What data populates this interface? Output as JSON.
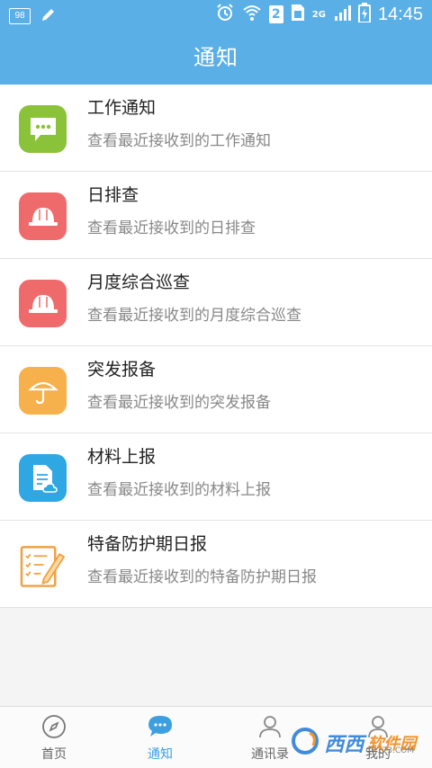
{
  "status_bar": {
    "battery_text": "98",
    "sim_number": "2",
    "network": "2G",
    "time": "14:45"
  },
  "header": {
    "title": "通知"
  },
  "notifications": [
    {
      "title": "工作通知",
      "subtitle": "查看最近接收到的工作通知",
      "icon": "message-icon",
      "color": "#8ac23a"
    },
    {
      "title": "日排查",
      "subtitle": "查看最近接收到的日排查",
      "icon": "helmet-icon",
      "color": "#ef6b6b"
    },
    {
      "title": "月度综合巡查",
      "subtitle": "查看最近接收到的月度综合巡查",
      "icon": "helmet-icon",
      "color": "#ef6b6b"
    },
    {
      "title": "突发报备",
      "subtitle": "查看最近接收到的突发报备",
      "icon": "umbrella-icon",
      "color": "#f6b14c"
    },
    {
      "title": "材料上报",
      "subtitle": "查看最近接收到的材料上报",
      "icon": "document-cloud-icon",
      "color": "#2fa7e3"
    },
    {
      "title": "特备防护期日报",
      "subtitle": "查看最近接收到的特备防护期日报",
      "icon": "checklist-pencil-icon",
      "color": "#f0a040"
    }
  ],
  "bottom_nav": [
    {
      "label": "首页",
      "icon": "compass-icon",
      "active": false
    },
    {
      "label": "通知",
      "icon": "chat-bubble-icon",
      "active": true
    },
    {
      "label": "通讯录",
      "icon": "contacts-icon",
      "active": false
    },
    {
      "label": "我的",
      "icon": "person-icon",
      "active": false
    }
  ],
  "watermark": {
    "text": "西西",
    "brand": "软件园",
    "url": "CR173.COM"
  },
  "colors": {
    "primary": "#5aafe6",
    "active_tab": "#3c9fe0"
  }
}
